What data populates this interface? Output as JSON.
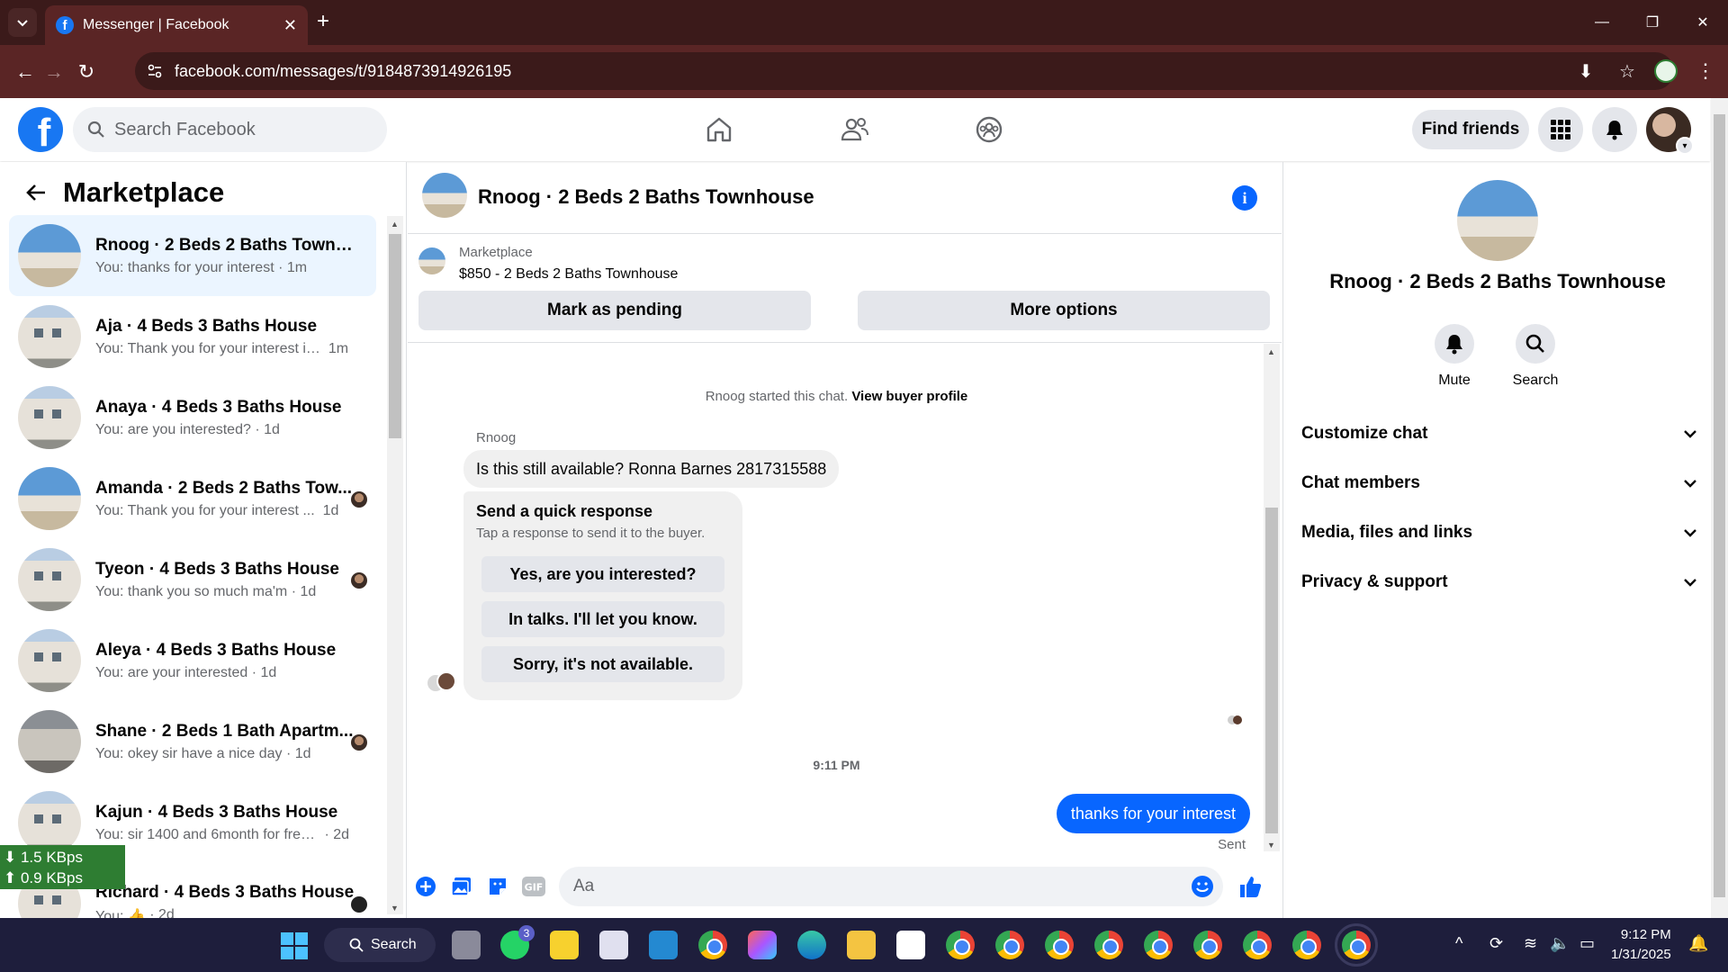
{
  "browser": {
    "tab_title": "Messenger | Facebook",
    "url": "facebook.com/messages/t/9184873914926195"
  },
  "fb": {
    "search_placeholder": "Search Facebook",
    "find_friends": "Find friends",
    "brand_color": "#1877f2"
  },
  "left": {
    "title": "Marketplace",
    "conversations": [
      {
        "name": "Rnoog · 2 Beds 2 Baths Townho...",
        "snippet": "You: thanks for your interest",
        "time": "1m"
      },
      {
        "name": "Aja · 4 Beds 3 Baths House",
        "snippet": "You: Thank you for your interest in...",
        "time": "1m"
      },
      {
        "name": "Anaya · 4 Beds 3 Baths House",
        "snippet": "You: are you interested?",
        "time": "1d"
      },
      {
        "name": "Amanda · 2 Beds 2 Baths Tow...",
        "snippet": "You: Thank you for your interest ...",
        "time": "1d"
      },
      {
        "name": "Tyeon · 4 Beds 3 Baths House",
        "snippet": "You: thank you so much ma'm",
        "time": "1d"
      },
      {
        "name": "Aleya · 4 Beds 3 Baths House",
        "snippet": "You: are your interested",
        "time": "1d"
      },
      {
        "name": "Shane · 2 Beds 1 Bath Apartm...",
        "snippet": "You: okey sir have a nice day",
        "time": "1d"
      },
      {
        "name": "Kajun · 4 Beds 3 Baths House",
        "snippet": "You: sir 1400 and 6month for free r...",
        "time": "2d"
      },
      {
        "name": "Richard · 4 Beds 3 Baths House",
        "snippet": "You: 👍",
        "time": "2d"
      }
    ]
  },
  "netspeed": {
    "down": "1.5 KBps",
    "up": "0.9 KBps"
  },
  "chat": {
    "title": "Rnoog · 2 Beds 2 Baths Townhouse",
    "listing_source": "Marketplace",
    "listing_price": "$850 - 2 Beds 2 Baths Townhouse",
    "mark_pending": "Mark as pending",
    "more_options": "More options",
    "system_text": "Rnoog started this chat.",
    "view_buyer": "View buyer profile",
    "sender": "Rnoog",
    "incoming": "Is this still available? Ronna Barnes 2817315588",
    "quick_title": "Send a quick response",
    "quick_sub": "Tap a response to send it to the buyer.",
    "quick_options": [
      "Yes, are you interested?",
      "In talks. I'll let you know.",
      "Sorry, it's not available."
    ],
    "time_sep": "9:11 PM",
    "outgoing": "thanks for your interest",
    "status": "Sent",
    "composer_placeholder": "Aa"
  },
  "right": {
    "name": "Rnoog · 2 Beds 2 Baths Townhouse",
    "actions": [
      "Mute",
      "Search"
    ],
    "sections": [
      "Customize chat",
      "Chat members",
      "Media, files and links",
      "Privacy & support"
    ]
  },
  "taskbar": {
    "search_label": "Search",
    "whatsapp_badge": "3",
    "time": "9:12 PM",
    "date": "1/31/2025"
  }
}
